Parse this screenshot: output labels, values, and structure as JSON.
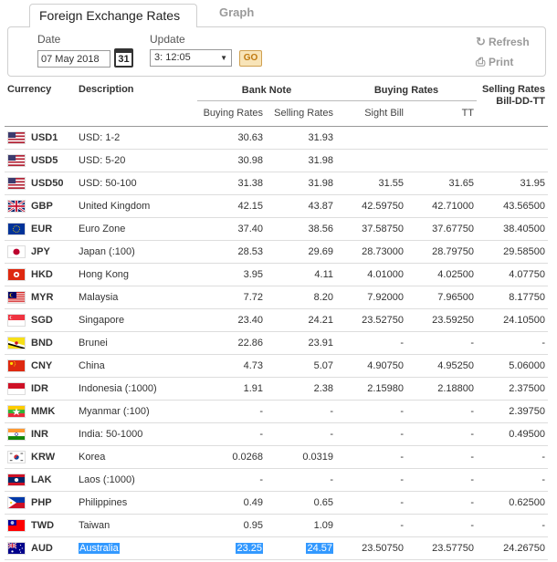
{
  "tabs": {
    "rates": "Foreign Exchange Rates",
    "graph": "Graph"
  },
  "controls": {
    "date_label": "Date",
    "date_value": "07 May 2018",
    "calendar_day": "31",
    "update_label": "Update",
    "update_value": "3: 12:05",
    "go_label": "GO",
    "refresh_label": "Refresh",
    "print_label": "Print"
  },
  "headers": {
    "currency": "Currency",
    "description": "Description",
    "bank_note": "Bank Note",
    "buying_rates": "Buying Rates",
    "selling_rates": "Selling Rates Bill-DD-TT",
    "sub_buying": "Buying Rates",
    "sub_selling": "Selling Rates",
    "sub_sight": "Sight Bill",
    "sub_tt": "TT"
  },
  "rows": [
    {
      "flag": "us",
      "code": "USD1",
      "desc": "USD: 1-2",
      "nb": "30.63",
      "ns": "31.93",
      "sight": "",
      "tt": "",
      "sell": ""
    },
    {
      "flag": "us",
      "code": "USD5",
      "desc": "USD: 5-20",
      "nb": "30.98",
      "ns": "31.98",
      "sight": "",
      "tt": "",
      "sell": ""
    },
    {
      "flag": "us",
      "code": "USD50",
      "desc": "USD: 50-100",
      "nb": "31.38",
      "ns": "31.98",
      "sight": "31.55",
      "tt": "31.65",
      "sell": "31.95"
    },
    {
      "flag": "gb",
      "code": "GBP",
      "desc": "United Kingdom",
      "nb": "42.15",
      "ns": "43.87",
      "sight": "42.59750",
      "tt": "42.71000",
      "sell": "43.56500"
    },
    {
      "flag": "eu",
      "code": "EUR",
      "desc": "Euro Zone",
      "nb": "37.40",
      "ns": "38.56",
      "sight": "37.58750",
      "tt": "37.67750",
      "sell": "38.40500"
    },
    {
      "flag": "jp",
      "code": "JPY",
      "desc": "Japan (:100)",
      "nb": "28.53",
      "ns": "29.69",
      "sight": "28.73000",
      "tt": "28.79750",
      "sell": "29.58500"
    },
    {
      "flag": "hk",
      "code": "HKD",
      "desc": "Hong Kong",
      "nb": "3.95",
      "ns": "4.11",
      "sight": "4.01000",
      "tt": "4.02500",
      "sell": "4.07750"
    },
    {
      "flag": "my",
      "code": "MYR",
      "desc": "Malaysia",
      "nb": "7.72",
      "ns": "8.20",
      "sight": "7.92000",
      "tt": "7.96500",
      "sell": "8.17750"
    },
    {
      "flag": "sg",
      "code": "SGD",
      "desc": "Singapore",
      "nb": "23.40",
      "ns": "24.21",
      "sight": "23.52750",
      "tt": "23.59250",
      "sell": "24.10500"
    },
    {
      "flag": "bn",
      "code": "BND",
      "desc": "Brunei",
      "nb": "22.86",
      "ns": "23.91",
      "sight": "-",
      "tt": "-",
      "sell": "-"
    },
    {
      "flag": "cn",
      "code": "CNY",
      "desc": "China",
      "nb": "4.73",
      "ns": "5.07",
      "sight": "4.90750",
      "tt": "4.95250",
      "sell": "5.06000"
    },
    {
      "flag": "id",
      "code": "IDR",
      "desc": "Indonesia (:1000)",
      "nb": "1.91",
      "ns": "2.38",
      "sight": "2.15980",
      "tt": "2.18800",
      "sell": "2.37500"
    },
    {
      "flag": "mm",
      "code": "MMK",
      "desc": "Myanmar (:100)",
      "nb": "-",
      "ns": "-",
      "sight": "-",
      "tt": "-",
      "sell": "2.39750"
    },
    {
      "flag": "in",
      "code": "INR",
      "desc": "India: 50-1000",
      "nb": "-",
      "ns": "-",
      "sight": "-",
      "tt": "-",
      "sell": "0.49500"
    },
    {
      "flag": "kr",
      "code": "KRW",
      "desc": "Korea",
      "nb": "0.0268",
      "ns": "0.0319",
      "sight": "-",
      "tt": "-",
      "sell": "-"
    },
    {
      "flag": "la",
      "code": "LAK",
      "desc": "Laos (:1000)",
      "nb": "-",
      "ns": "-",
      "sight": "-",
      "tt": "-",
      "sell": "-"
    },
    {
      "flag": "ph",
      "code": "PHP",
      "desc": "Philippines",
      "nb": "0.49",
      "ns": "0.65",
      "sight": "-",
      "tt": "-",
      "sell": "0.62500"
    },
    {
      "flag": "tw",
      "code": "TWD",
      "desc": "Taiwan",
      "nb": "0.95",
      "ns": "1.09",
      "sight": "-",
      "tt": "-",
      "sell": "-"
    },
    {
      "flag": "au",
      "code": "AUD",
      "desc": "Australia",
      "nb": "23.25",
      "ns": "24.57",
      "sight": "23.50750",
      "tt": "23.57750",
      "sell": "24.26750",
      "selected": true
    }
  ]
}
